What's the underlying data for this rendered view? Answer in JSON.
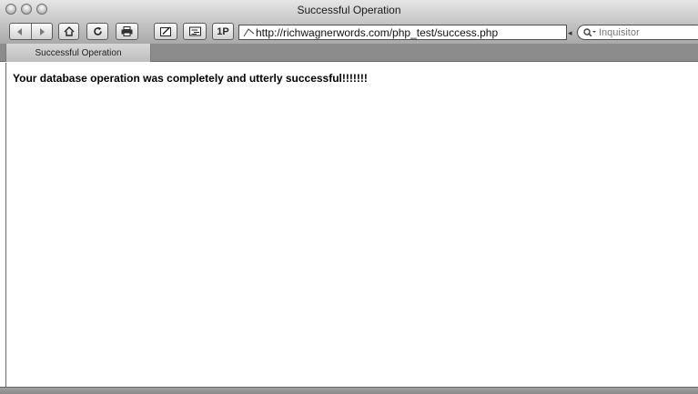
{
  "window": {
    "title": "Successful Operation"
  },
  "toolbar": {
    "onep_label": "1P",
    "url": "http://richwagnerwords.com/php_test/success.php",
    "search_placeholder": "Inquisitor"
  },
  "tab": {
    "label": "Successful Operation"
  },
  "page": {
    "message": "Your database operation was completely and utterly successful!!!!!!!"
  },
  "icons": {
    "traffic": "traffic-light-icon",
    "back": "back-arrow-icon",
    "forward": "forward-arrow-icon",
    "home": "home-icon",
    "reload": "reload-icon",
    "print": "print-icon",
    "edit": "edit-icon",
    "tabs": "tabs-icon",
    "url": "url-check-icon",
    "search": "search-icon"
  }
}
